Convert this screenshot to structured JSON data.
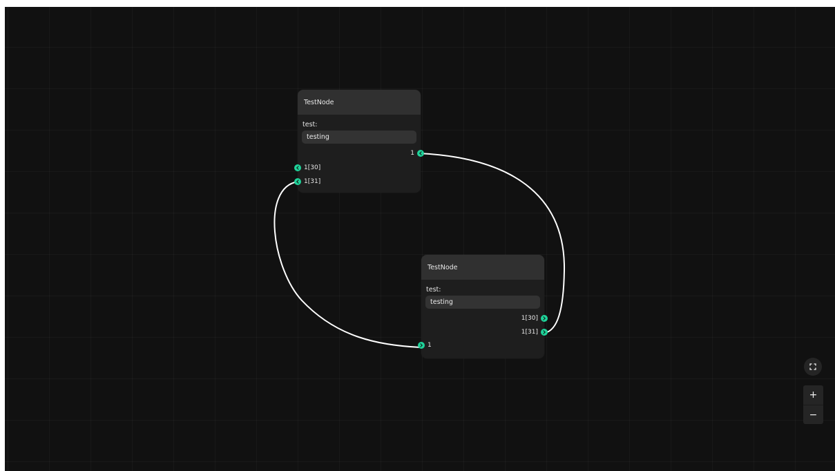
{
  "editor": {
    "theme": {
      "background": "#111111",
      "node_bg": "#1e1e1e",
      "node_header": "#303030",
      "socket": "#1fd39a",
      "wire": "#ffffff"
    },
    "nodes": [
      {
        "title": "TestNode",
        "field_label": "test:",
        "field_value": "testing",
        "outputs": [
          "1"
        ],
        "inputs": [
          "1[30]",
          "1[31]"
        ]
      },
      {
        "title": "TestNode",
        "field_label": "test:",
        "field_value": "testing",
        "outputs": [
          "1[30]",
          "1[31]"
        ],
        "inputs": [
          "1"
        ]
      }
    ],
    "connections": [
      {
        "from": "node 1 output 1",
        "to": "node 2 output 1[31]"
      },
      {
        "from": "node 1 input 1[31]",
        "to": "node 2 input 1"
      }
    ]
  },
  "controls": {
    "fit_icon": "fit-view-icon",
    "zoom_in_label": "+",
    "zoom_out_label": "−"
  }
}
